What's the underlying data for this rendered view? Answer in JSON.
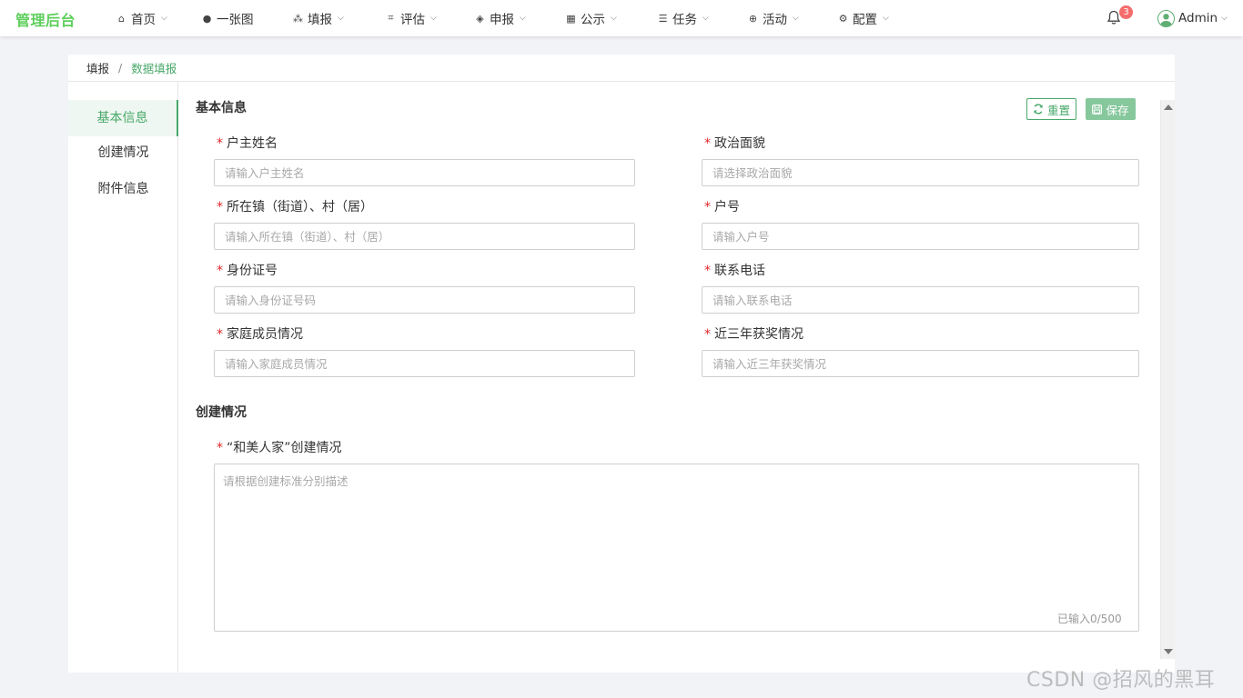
{
  "brand": "管理后台",
  "nav": [
    {
      "label": "首页",
      "icon": "home-icon",
      "glyph": "⌂",
      "dropdown": true
    },
    {
      "label": "一张图",
      "icon": "globe-icon",
      "glyph": "●",
      "dropdown": false
    },
    {
      "label": "填报",
      "icon": "cubes-icon",
      "glyph": "⁂",
      "dropdown": true
    },
    {
      "label": "评估",
      "icon": "crop-icon",
      "glyph": "⌗",
      "dropdown": true
    },
    {
      "label": "申报",
      "icon": "layers-icon",
      "glyph": "◈",
      "dropdown": true
    },
    {
      "label": "公示",
      "icon": "building-icon",
      "glyph": "▦",
      "dropdown": true
    },
    {
      "label": "任务",
      "icon": "server-icon",
      "glyph": "☰",
      "dropdown": true
    },
    {
      "label": "活动",
      "icon": "lifebuoy-icon",
      "glyph": "⊕",
      "dropdown": true
    },
    {
      "label": "配置",
      "icon": "gear-icon",
      "glyph": "⚙",
      "dropdown": true
    }
  ],
  "notifications": {
    "count": "3"
  },
  "user": {
    "name": "Admin"
  },
  "breadcrumb": {
    "parent": "填报",
    "separator": "/",
    "current": "数据填报"
  },
  "sidebar": {
    "items": [
      {
        "label": "基本信息",
        "active": true
      },
      {
        "label": "创建情况",
        "active": false
      },
      {
        "label": "附件信息",
        "active": false
      }
    ]
  },
  "toolbar": {
    "reset_label": "重置",
    "save_label": "保存"
  },
  "basic_info": {
    "title": "基本信息",
    "fields": [
      {
        "label": "户主姓名",
        "placeholder": "请输入户主姓名",
        "value": ""
      },
      {
        "label": "政治面貌",
        "placeholder": "请选择政治面貌",
        "value": ""
      },
      {
        "label": "所在镇（街道）、村（居）",
        "placeholder": "请输入所在镇（街道）、村（居）",
        "value": ""
      },
      {
        "label": "户号",
        "placeholder": "请输入户号",
        "value": ""
      },
      {
        "label": "身份证号",
        "placeholder": "请输入身份证号码",
        "value": ""
      },
      {
        "label": "联系电话",
        "placeholder": "请输入联系电话",
        "value": ""
      },
      {
        "label": "家庭成员情况",
        "placeholder": "请输入家庭成员情况",
        "value": ""
      },
      {
        "label": "近三年获奖情况",
        "placeholder": "请输入近三年获奖情况",
        "value": ""
      }
    ]
  },
  "creation": {
    "title": "创建情况",
    "field_label": "“和美人家”创建情况",
    "placeholder": "请根据创建标准分别描述",
    "value": "",
    "counter": "已输入0/500"
  },
  "required_mark": "*",
  "watermark": "CSDN @招风的黑耳",
  "colors": {
    "brand": "#5dce5a",
    "accent": "#4aa86a",
    "required": "#e02828",
    "badge": "#f56c6c"
  }
}
